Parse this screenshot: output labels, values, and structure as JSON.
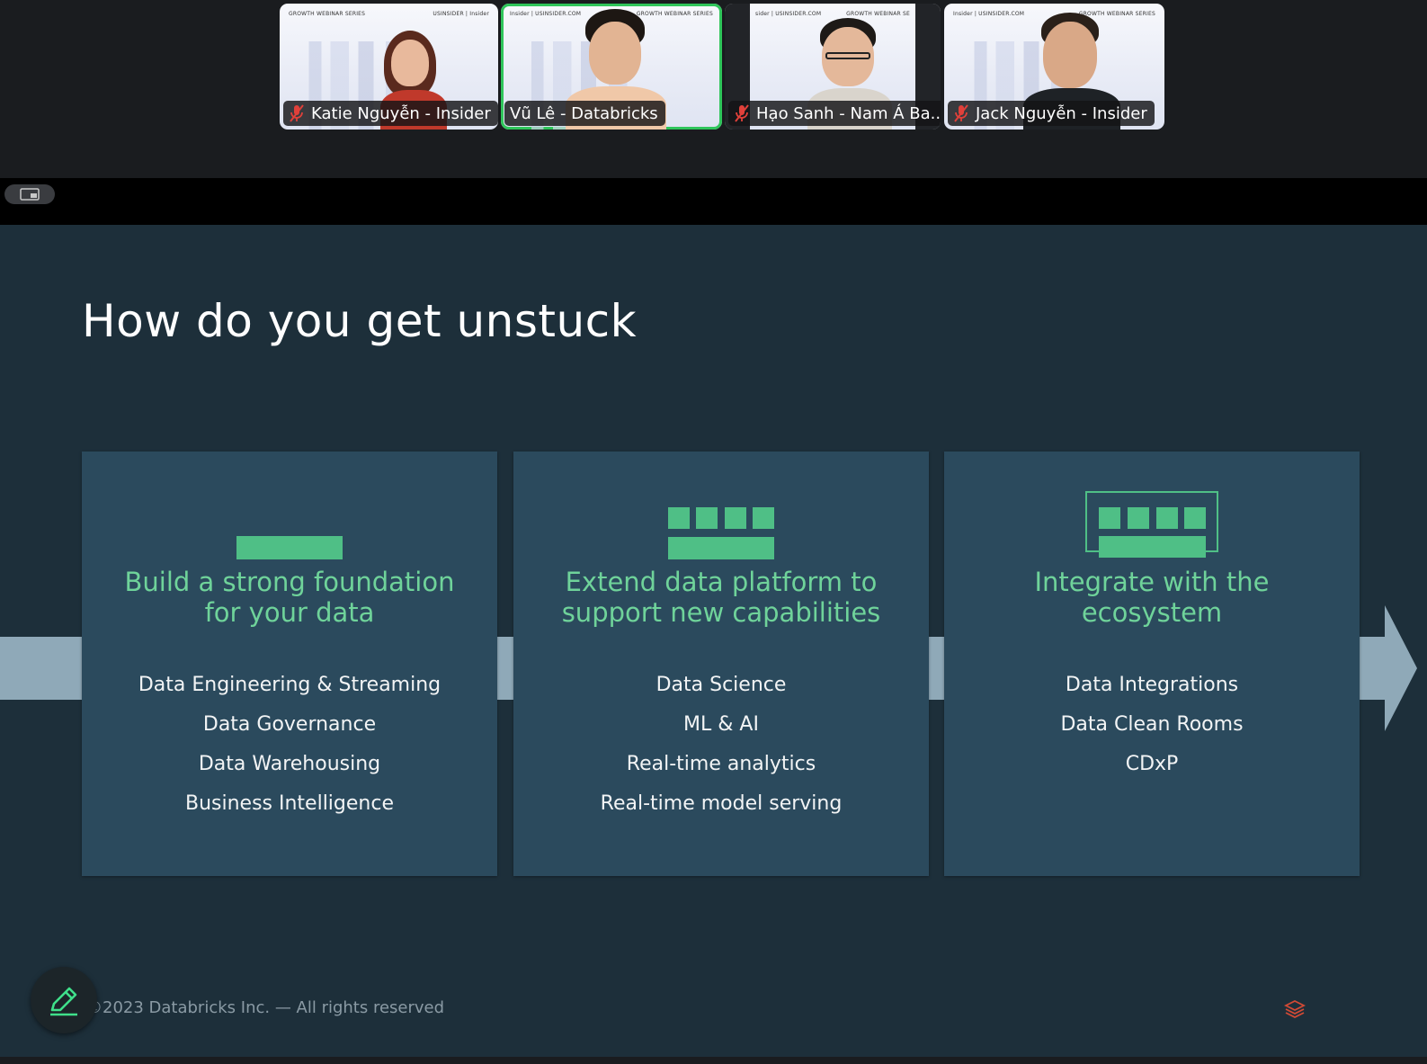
{
  "participants": [
    {
      "name": "Katie Nguyễn - Insider",
      "muted": true
    },
    {
      "name": "Vũ Lê - Databricks",
      "muted": false,
      "speaking": true
    },
    {
      "name": "Hạo Sanh - Nam Á Ba...",
      "muted": true
    },
    {
      "name": "Jack Nguyễn - Insider",
      "muted": true
    }
  ],
  "slide": {
    "title": "How do you get unstuck",
    "cards": [
      {
        "heading": [
          "Build a strong foundation",
          "for your data"
        ],
        "items": [
          "Data Engineering & Streaming",
          "Data Governance",
          "Data Warehousing",
          "Business Intelligence"
        ],
        "icon": "foundation-bar-icon"
      },
      {
        "heading": [
          "Extend data platform to",
          "support new capabilities"
        ],
        "items": [
          "Data Science",
          "ML & AI",
          "Real-time analytics",
          "Real-time model serving"
        ],
        "icon": "platform-blocks-icon"
      },
      {
        "heading": [
          "Integrate with the",
          "ecosystem"
        ],
        "items": [
          "Data Integrations",
          "Data Clean Rooms",
          "CDxP"
        ],
        "icon": "ecosystem-frame-icon"
      }
    ],
    "footer": "©2023 Databricks Inc. — All rights reserved"
  },
  "colors": {
    "accent_green": "#6fd39a",
    "speaker_outline": "#2fc55a",
    "slide_bg": "#1d2f3a",
    "card_bg": "#2b4a5d"
  },
  "icons": {
    "view_toggle": "screen-layout-icon",
    "annotate": "pencil-icon",
    "mic": "mic-off-icon",
    "brand": "databricks-logo-icon"
  }
}
